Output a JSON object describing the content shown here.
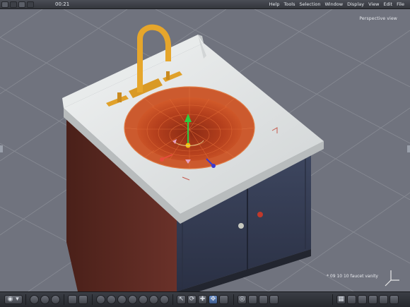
{
  "menubar": {
    "time": "00:21",
    "menus": [
      "Help",
      "Tools",
      "Selection",
      "Window",
      "Display",
      "View",
      "Edit",
      "File"
    ]
  },
  "viewport": {
    "title": "Perspective view",
    "caption": "* 09 10 10 faucet vanity"
  },
  "colors": {
    "viewport_bg": "#70737e",
    "countertop": "#dfe2e2",
    "cabinet_side": "#5a2a24",
    "cabinet_front": "#3b4458",
    "basin_rim": "#c9562d",
    "faucet": "#e0a12a",
    "grid": "#8a8d96"
  },
  "icons": {
    "toolbar": [
      "render-icon",
      "camera-icon",
      "sphere-icon",
      "cube-icon",
      "select-icon",
      "rotate-icon",
      "scale-icon",
      "move-icon",
      "eye-icon",
      "layout-icon"
    ]
  }
}
